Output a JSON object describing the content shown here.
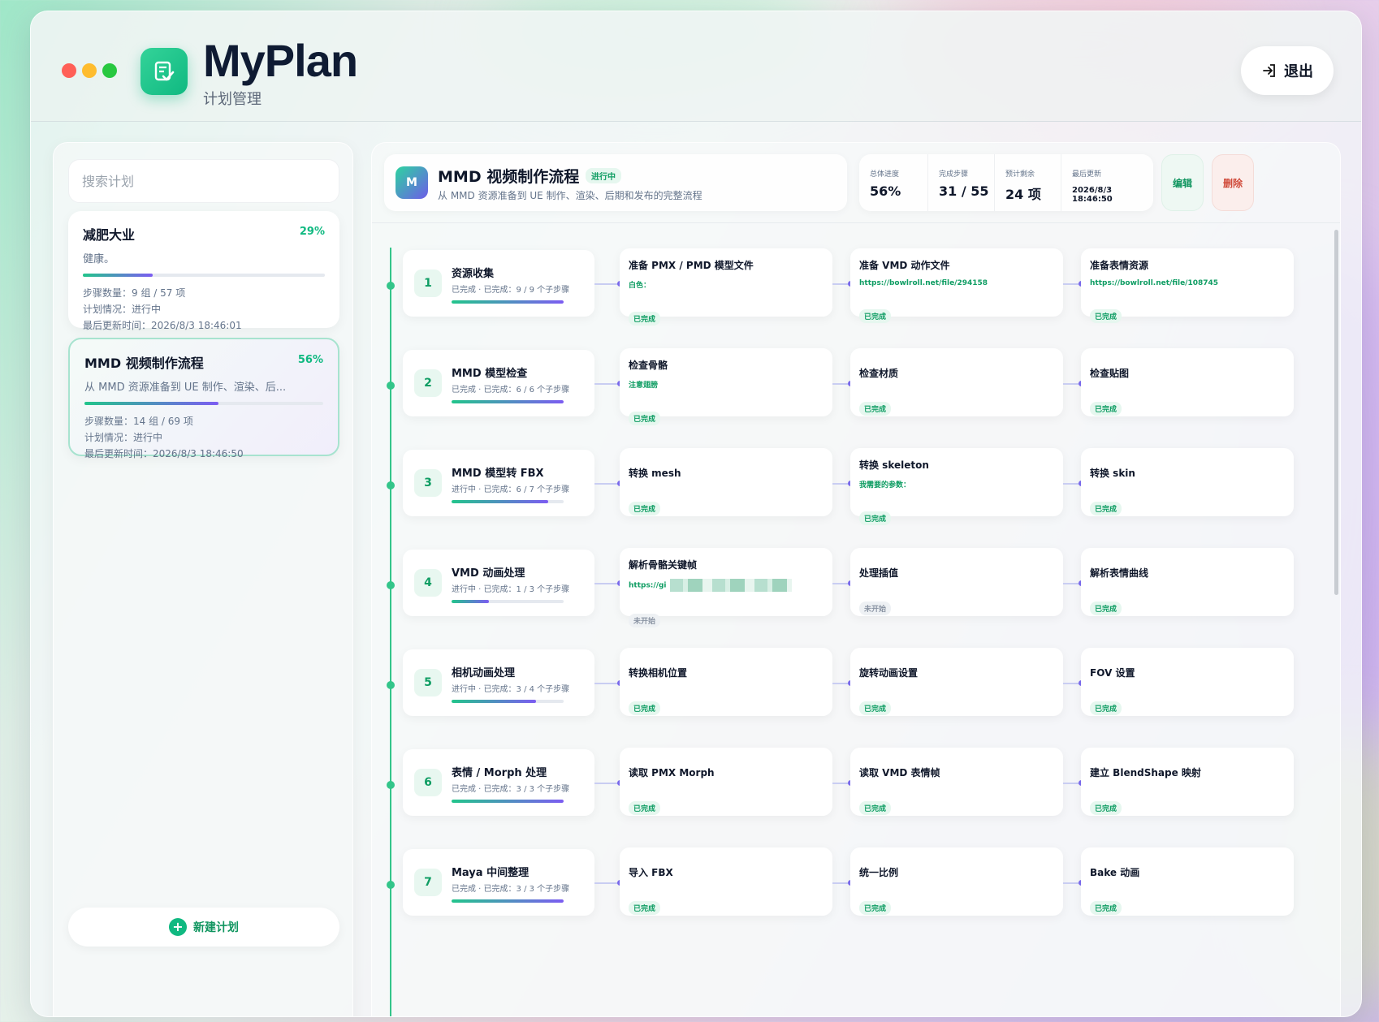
{
  "app": {
    "title": "MyPlan",
    "subtitle": "计划管理",
    "logout_label": "退出"
  },
  "sidebar": {
    "search_placeholder": "搜索计划",
    "new_plan_label": "新建计划",
    "plans": [
      {
        "title": "减肥大业",
        "percent_label": "29%",
        "progress": 0.29,
        "desc": "健康。",
        "steps": "步骤数量：9 组 / 57 项",
        "status": "计划情况：进行中",
        "updated": "最后更新时间：2026/8/3 18:46:01"
      },
      {
        "title": "MMD 视频制作流程",
        "percent_label": "56%",
        "progress": 0.56,
        "desc": "从 MMD 资源准备到 UE 制作、渲染、后...",
        "steps": "步骤数量：14 组 / 69 项",
        "status": "计划情况：进行中",
        "updated": "最后更新时间：2026/8/3 18:46:50"
      }
    ]
  },
  "plan": {
    "icon_letter": "M",
    "title": "MMD 视频制作流程",
    "badge": "进行中",
    "desc": "从 MMD 资源准备到 UE 制作、渲染、后期和发布的完整流程",
    "stats": [
      {
        "label": "总体进度",
        "value": "56%"
      },
      {
        "label": "完成步骤",
        "value": "31 / 55"
      },
      {
        "label": "预计剩余",
        "value": "24 项"
      },
      {
        "label": "最后更新",
        "value": "2026/8/3 18:46:50"
      }
    ],
    "edit_label": "编辑",
    "delete_label": "删除"
  },
  "steps": [
    {
      "num": "1",
      "title": "资源收集",
      "sub": "已完成 · 已完成：9 / 9 个子步骤",
      "progress": 1.0,
      "items": [
        {
          "title": "准备 PMX / PMD 模型文件",
          "note": "白色：",
          "status": "已完成",
          "done": true
        },
        {
          "title": "准备 VMD 动作文件",
          "note": "https://bowlroll.net/file/294158",
          "status": "已完成",
          "done": true
        },
        {
          "title": "准备表情资源",
          "note": "https://bowlroll.net/file/108745",
          "status": "已完成",
          "done": true
        }
      ]
    },
    {
      "num": "2",
      "title": "MMD 模型检查",
      "sub": "已完成 · 已完成：6 / 6 个子步骤",
      "progress": 1.0,
      "items": [
        {
          "title": "检查骨骼",
          "note": "注意翅膀",
          "status": "已完成",
          "done": true
        },
        {
          "title": "检查材质",
          "note": "",
          "status": "已完成",
          "done": true
        },
        {
          "title": "检查贴图",
          "note": "",
          "status": "已完成",
          "done": true
        }
      ]
    },
    {
      "num": "3",
      "title": "MMD 模型转 FBX",
      "sub": "进行中 · 已完成：6 / 7 个子步骤",
      "progress": 0.86,
      "items": [
        {
          "title": "转换 mesh",
          "note": "",
          "status": "已完成",
          "done": true
        },
        {
          "title": "转换 skeleton",
          "note": "我需要的参数：",
          "status": "已完成",
          "done": true
        },
        {
          "title": "转换 skin",
          "note": "",
          "status": "已完成",
          "done": true
        }
      ]
    },
    {
      "num": "4",
      "title": "VMD 动画处理",
      "sub": "进行中 · 已完成：1 / 3 个子步骤",
      "progress": 0.33,
      "items": [
        {
          "title": "解析骨骼关键帧",
          "note": "https://gi",
          "status": "未开始",
          "done": false,
          "blurred": true
        },
        {
          "title": "处理插值",
          "note": "",
          "status": "未开始",
          "done": false
        },
        {
          "title": "解析表情曲线",
          "note": "",
          "status": "已完成",
          "done": true
        }
      ]
    },
    {
      "num": "5",
      "title": "相机动画处理",
      "sub": "进行中 · 已完成：3 / 4 个子步骤",
      "progress": 0.75,
      "items": [
        {
          "title": "转换相机位置",
          "note": "",
          "status": "已完成",
          "done": true
        },
        {
          "title": "旋转动画设置",
          "note": "",
          "status": "已完成",
          "done": true
        },
        {
          "title": "FOV 设置",
          "note": "",
          "status": "已完成",
          "done": true
        }
      ]
    },
    {
      "num": "6",
      "title": "表情 / Morph 处理",
      "sub": "已完成 · 已完成：3 / 3 个子步骤",
      "progress": 1.0,
      "items": [
        {
          "title": "读取 PMX Morph",
          "note": "",
          "status": "已完成",
          "done": true
        },
        {
          "title": "读取 VMD 表情帧",
          "note": "",
          "status": "已完成",
          "done": true
        },
        {
          "title": "建立 BlendShape 映射",
          "note": "",
          "status": "已完成",
          "done": true
        }
      ]
    },
    {
      "num": "7",
      "title": "Maya 中间整理",
      "sub": "已完成 · 已完成：3 / 3 个子步骤",
      "progress": 1.0,
      "items": [
        {
          "title": "导入 FBX",
          "note": "",
          "status": "已完成",
          "done": true
        },
        {
          "title": "统一比例",
          "note": "",
          "status": "已完成",
          "done": true
        },
        {
          "title": "Bake 动画",
          "note": "",
          "status": "已完成",
          "done": true
        }
      ]
    }
  ]
}
